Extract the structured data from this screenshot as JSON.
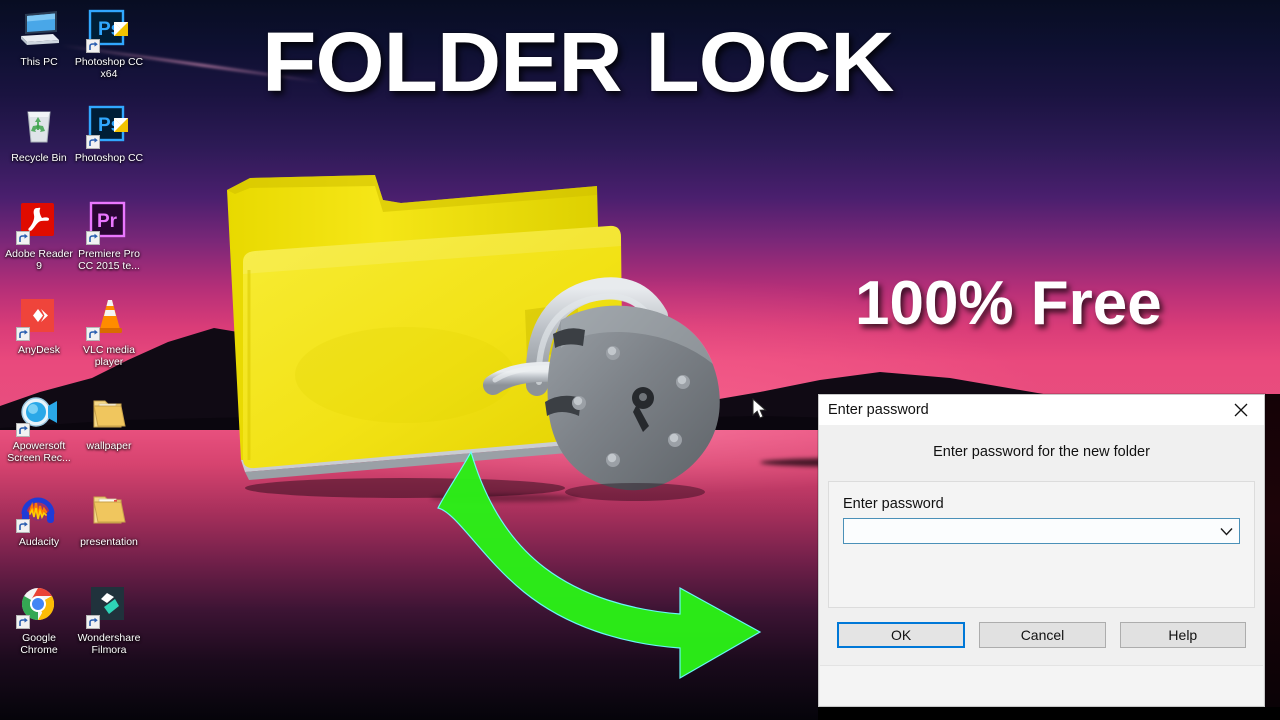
{
  "desktop": {
    "icons": [
      {
        "label": "This PC",
        "icon": "computer-icon",
        "shortcut": false
      },
      {
        "label": "Photoshop CC x64",
        "icon": "photoshop-icon",
        "shortcut": true
      },
      {
        "label": "Recycle Bin",
        "icon": "recycle-bin-icon",
        "shortcut": false
      },
      {
        "label": "Photoshop CC",
        "icon": "photoshop-icon",
        "shortcut": true
      },
      {
        "label": "Adobe Reader 9",
        "icon": "adobe-reader-icon",
        "shortcut": true
      },
      {
        "label": "Premiere Pro CC 2015 te...",
        "icon": "premiere-pro-icon",
        "shortcut": true
      },
      {
        "label": "AnyDesk",
        "icon": "anydesk-icon",
        "shortcut": true
      },
      {
        "label": "VLC media player",
        "icon": "vlc-icon",
        "shortcut": true
      },
      {
        "label": "Apowersoft Screen Rec...",
        "icon": "apowersoft-icon",
        "shortcut": true
      },
      {
        "label": "wallpaper",
        "icon": "folder-icon",
        "shortcut": false
      },
      {
        "label": "Audacity",
        "icon": "audacity-icon",
        "shortcut": true
      },
      {
        "label": "presentation",
        "icon": "folder-icon",
        "shortcut": false
      },
      {
        "label": "Google Chrome",
        "icon": "chrome-icon",
        "shortcut": true
      },
      {
        "label": "Wondershare Filmora",
        "icon": "filmora-icon",
        "shortcut": true
      }
    ],
    "wallpaper_name": "sunset-lake-wallpaper"
  },
  "overlay": {
    "title": "FOLDER LOCK",
    "badge": "100% Free",
    "arrow": "curved-green-arrow",
    "graphic": "yellow-folder-with-padlock"
  },
  "dialog": {
    "title": "Enter password",
    "close_label": "✕",
    "heading": "Enter password for the new folder",
    "field": {
      "label": "Enter password",
      "value": "",
      "placeholder": ""
    },
    "ghost_text": "",
    "buttons": [
      {
        "label": "OK",
        "default": true
      },
      {
        "label": "Cancel",
        "default": false
      },
      {
        "label": "Help",
        "default": false
      }
    ]
  },
  "colors": {
    "accent_blue": "#0078d7",
    "combo_border": "#4a90b8",
    "folder_yellow": "#f2e215",
    "lock_grey": "#7d7f84",
    "arrow_green": "#2bf017",
    "dialog_bg": "#f0f0f0",
    "titlebar_bg": "#ffffff",
    "sky_top": "#080d22",
    "sky_mid": "#4a1f6e",
    "sky_glow": "#e8507e"
  }
}
